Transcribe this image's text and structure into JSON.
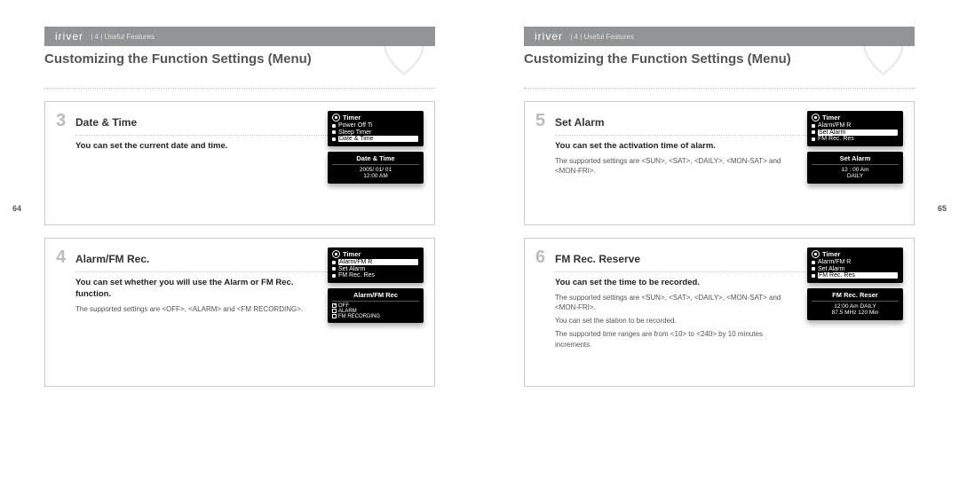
{
  "left": {
    "brand": "iriver",
    "crumb": "4 | Useful Features",
    "title": "Customizing the Function Settings (Menu)",
    "pagenum": "64",
    "box1": {
      "num": "3",
      "title": "Date & Time",
      "bold": "You can set the current date and time.",
      "lcd_menu_title": "Timer",
      "lcd_items": {
        "a": "Power Off Ti",
        "b": "Sleep Timer",
        "c": "Date & Time"
      },
      "sub_title": "Date & Time",
      "sub_body": "2005/ 01/ 01\n12:00 AM"
    },
    "box2": {
      "num": "4",
      "title": "Alarm/FM Rec.",
      "bold": "You can set whether you will use the Alarm or FM Rec. function.",
      "small": "The supported settings are <OFF>, <ALARM> and <FM RECORDING>.",
      "lcd_menu_title": "Timer",
      "lcd_items": {
        "a": "Alarm/FM R",
        "b": "Set Alarm",
        "c": "FM Rec. Res"
      },
      "sub_title": "Alarm/FM Rec",
      "check": {
        "a": "OFF",
        "b": "ALARM",
        "c": "FM RECORDING"
      }
    }
  },
  "right": {
    "brand": "iriver",
    "crumb": "4 | Useful Features",
    "title": "Customizing the Function Settings (Menu)",
    "pagenum": "65",
    "box1": {
      "num": "5",
      "title": "Set Alarm",
      "bold": "You can set the activation time of alarm.",
      "small": "The supported settings are <SUN>, <SAT>, <DAILY>, <MON-SAT> and <MON-FRI>.",
      "lcd_menu_title": "Timer",
      "lcd_items": {
        "a": "Alarm/FM R",
        "b": "Set Alarm",
        "c": "FM Rec. Res"
      },
      "sub_title": "Set Alarm",
      "sub_body": "12 : 00 Am\nDAILY"
    },
    "box2": {
      "num": "6",
      "title": "FM Rec. Reserve",
      "bold": "You can set the time to be recorded.",
      "small1": "The supported settings are <SUN>, <SAT>, <DAILY>, <MON-SAT> and <MON-FRI>.",
      "small2": "You can set the station to be recorded.",
      "small3": "The supported time ranges are from <10> to <240> by 10 minutes increments.",
      "lcd_menu_title": "Timer",
      "lcd_items": {
        "a": "Alarm/FM R",
        "b": "Set Alarm",
        "c": "FM Rec. Res"
      },
      "sub_title": "FM Rec. Reser",
      "sub_body": "12:00 Am   DAILY\n87.5 MHz   120 Min"
    }
  }
}
